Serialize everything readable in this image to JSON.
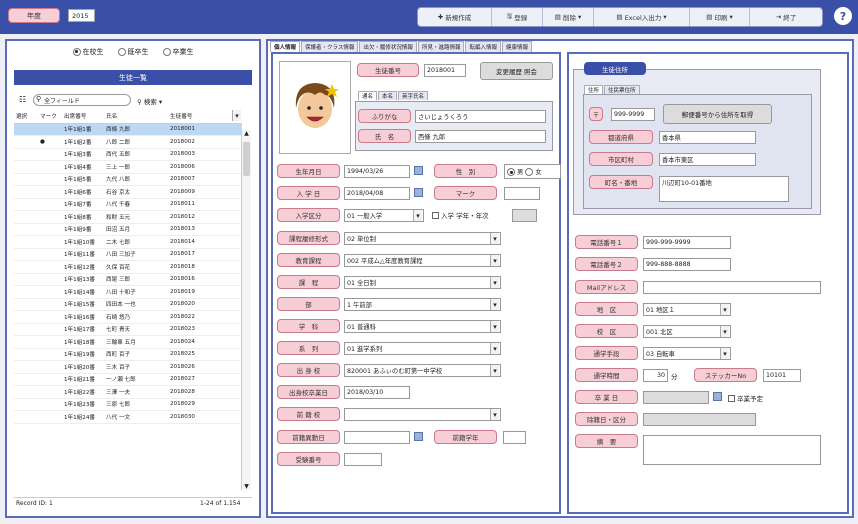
{
  "top": {
    "year_label": "年度",
    "year_value": "2015",
    "help": "?"
  },
  "toolbar": [
    "新規作成",
    "登録",
    "削除",
    "Excel入出力",
    "印刷",
    "終了"
  ],
  "left": {
    "radios": [
      {
        "label": "在校生",
        "on": true
      },
      {
        "label": "既卒生",
        "on": false
      },
      {
        "label": "卒業生",
        "on": false
      }
    ],
    "list_title": "生徒一覧",
    "search_placeholder": "全フィールド",
    "search_btn": "検索",
    "columns": [
      "選択",
      "マーク",
      "出席番号",
      "氏名",
      "生徒番号"
    ],
    "rows": [
      [
        "",
        "",
        "1年1組1番",
        "西條 九郎",
        "2018001"
      ],
      [
        "",
        "●",
        "1年1組2番",
        "八郎 二郎",
        "2018002"
      ],
      [
        "",
        "",
        "1年1組3番",
        "西代 五郎",
        "2018003"
      ],
      [
        "",
        "",
        "1年1組4番",
        "三上 一郎",
        "2018006"
      ],
      [
        "",
        "",
        "1年1組5番",
        "九代 八郎",
        "2018007"
      ],
      [
        "",
        "",
        "1年1組6番",
        "石谷 京太",
        "2018009"
      ],
      [
        "",
        "",
        "1年1組7番",
        "八代 千春",
        "2018011"
      ],
      [
        "",
        "",
        "1年1組8番",
        "和財 五元",
        "2018012"
      ],
      [
        "",
        "",
        "1年1組9番",
        "田沼 五月",
        "2018013"
      ],
      [
        "",
        "",
        "1年1組10番",
        "二木 七郎",
        "2018014"
      ],
      [
        "",
        "",
        "1年1組11番",
        "八田 三加子",
        "2018017"
      ],
      [
        "",
        "",
        "1年1組12番",
        "久保 百花",
        "2018018"
      ],
      [
        "",
        "",
        "1年1組13番",
        "西尾 三郎",
        "2018016"
      ],
      [
        "",
        "",
        "1年1組14番",
        "八田 十和子",
        "2018019"
      ],
      [
        "",
        "",
        "1年1組15番",
        "四田本 一也",
        "2018020"
      ],
      [
        "",
        "",
        "1年1組16番",
        "石崎 悠乃",
        "2018022"
      ],
      [
        "",
        "",
        "1年1組17番",
        "七町 青天",
        "2018023"
      ],
      [
        "",
        "",
        "1年1組18番",
        "三輪車 五月",
        "2018024"
      ],
      [
        "",
        "",
        "1年1組19番",
        "西町 百子",
        "2018025"
      ],
      [
        "",
        "",
        "1年1組20番",
        "三木 百子",
        "2018026"
      ],
      [
        "",
        "",
        "1年1組21番",
        "一ノ瀬 七郎",
        "2018027"
      ],
      [
        "",
        "",
        "1年1組22番",
        "三澤 一夫",
        "2018028"
      ],
      [
        "",
        "",
        "1年1組23番",
        "三原 七郎",
        "2018029"
      ],
      [
        "",
        "",
        "1年1組24番",
        "八代 一文",
        "2018030"
      ]
    ],
    "record_id": "Record ID: 1",
    "record_count": "1-24 of 1,154"
  },
  "tabs": [
    "個人情報",
    "保護者・クラス情報",
    "出欠・履修状況情報",
    "所見・進路情報",
    "転編入情報",
    "健康情報"
  ],
  "form": {
    "student_no_label": "生徒番号",
    "student_no": "2018001",
    "history_btn": "変更履歴 照会",
    "name_tabs": [
      "通名",
      "本名",
      "英字氏名"
    ],
    "kana_label": "ふりがな",
    "kana": "さいじょうくろう",
    "name_label": "氏　名",
    "name": "西條 九郎",
    "birth_label": "生年月日",
    "birth": "1994/03/26",
    "sex_label": "性　別",
    "sex_m": "男",
    "sex_f": "女",
    "enroll_label": "入 学 日",
    "enroll": "2018/04/08",
    "mark_label": "マーク",
    "enroll_type_label": "入学区分",
    "enroll_type": "01 一般入学",
    "enroll_year_label": "入学 学年・年次",
    "course_label": "課程履修形式",
    "course": "02 単位制",
    "curriculum_label": "教育課程",
    "curriculum": "002 平成ム△年度教育課程",
    "division_label": "課　程",
    "division": "01 全日制",
    "dept_label": "部",
    "dept": "1 午前部",
    "subject_label": "学　科",
    "subject": "01 普通科",
    "series_label": "系　列",
    "series": "01 進学系列",
    "school_label": "出 身 校",
    "school": "820001 あふぃのむ町第一中学校",
    "grad_label": "出身校卒業日",
    "grad": "2018/03/10",
    "prev_label": "前 籍 校",
    "prev_date_label": "前籍異動日",
    "prev_grade_label": "前籍学年",
    "exam_label": "受験番号"
  },
  "address": {
    "title": "生徒住所",
    "tabs": [
      "住所",
      "住民票住所"
    ],
    "zip_label": "〒",
    "zip": "999-9999",
    "zip_btn": "郵便番号から住所を取得",
    "pref_label": "都道府県",
    "pref": "香本県",
    "city_label": "市区町村",
    "city": "香本市東区",
    "street_label": "町名・番地",
    "street": "川辺町10-01番地"
  },
  "contact": {
    "tel1_label": "電話番号１",
    "tel1": "999-999-9999",
    "tel2_label": "電話番号２",
    "tel2": "999-888-8888",
    "mail_label": "Mailアドレス",
    "area_label": "地　区",
    "area": "01 地区１",
    "school_area_label": "校　区",
    "school_area": "001 北区",
    "commute_label": "通学手段",
    "commute": "03 自転車",
    "time_label": "通学時間",
    "time": "30",
    "time_unit": "分",
    "sticker_label": "ステッカーNo",
    "sticker": "10101",
    "grad_date_label": "卒 業 日",
    "grad_plan": "卒業予定",
    "exclude_label": "除籍日・区分",
    "note_label": "摘　要"
  }
}
